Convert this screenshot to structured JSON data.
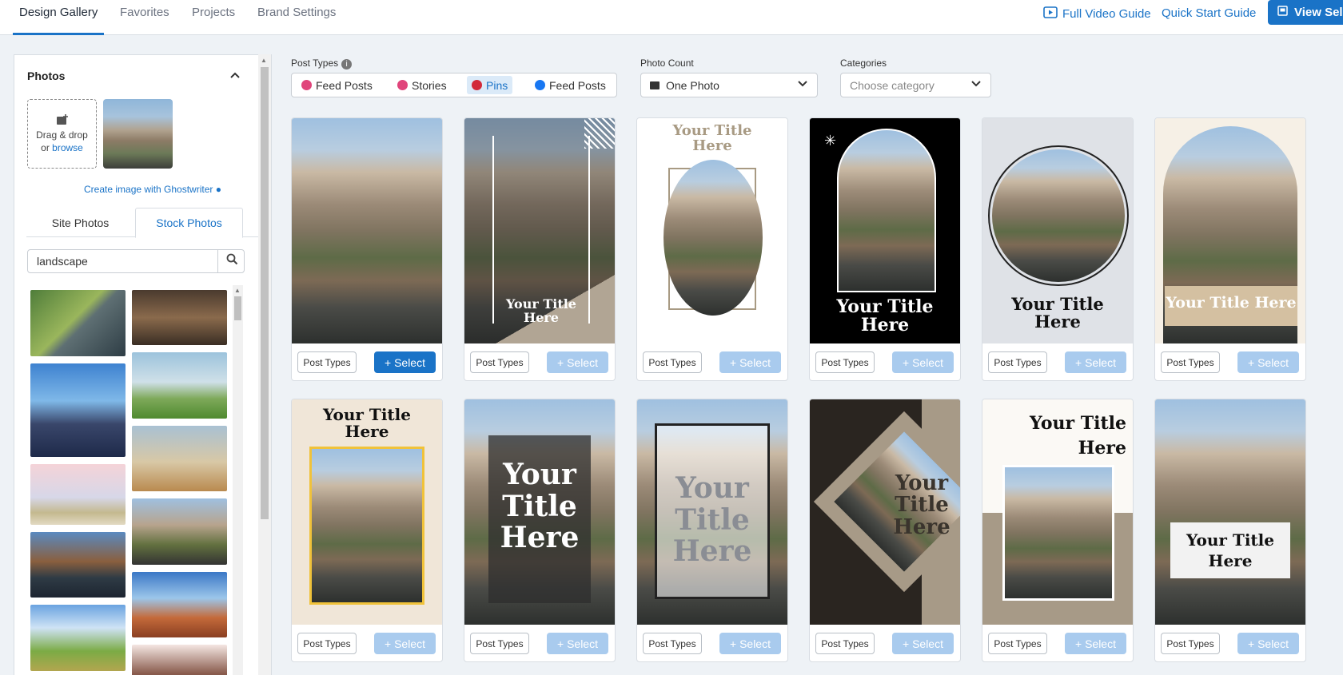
{
  "topnav": {
    "tabs": [
      "Design Gallery",
      "Favorites",
      "Projects",
      "Brand Settings"
    ],
    "full_video_guide": "Full Video Guide",
    "quick_start_guide": "Quick Start Guide",
    "view_selected": "View Sel"
  },
  "sidebar": {
    "title": "Photos",
    "drop_text": "Drag & drop",
    "or_text": "or",
    "browse_text": "browse",
    "ghostwriter": "Create image with Ghostwriter",
    "tabs": [
      "Site Photos",
      "Stock Photos"
    ],
    "search_value": "landscape",
    "stock_colors": [
      "#6c8a4e",
      "#5a4634",
      "#3f6fb5",
      "#7fb0c9",
      "#c99a64",
      "#d8c3c8",
      "#7f8e95",
      "#5b6378",
      "#3d76c2",
      "#6fa24f",
      "#8a5f52"
    ]
  },
  "filters": {
    "post_types_label": "Post Types",
    "post_types": [
      "Feed Posts",
      "Stories",
      "Pins",
      "Feed Posts"
    ],
    "photo_count_label": "Photo Count",
    "photo_count_value": "One Photo",
    "categories_label": "Categories",
    "categories_placeholder": "Choose category"
  },
  "cards": {
    "post_types_label": "Post Types",
    "select_label": "+ Select",
    "title_two_line": "Your Title\nHere",
    "title_one_line": "Your Title Here",
    "title_three_line": "Your\nTitle\nHere"
  }
}
